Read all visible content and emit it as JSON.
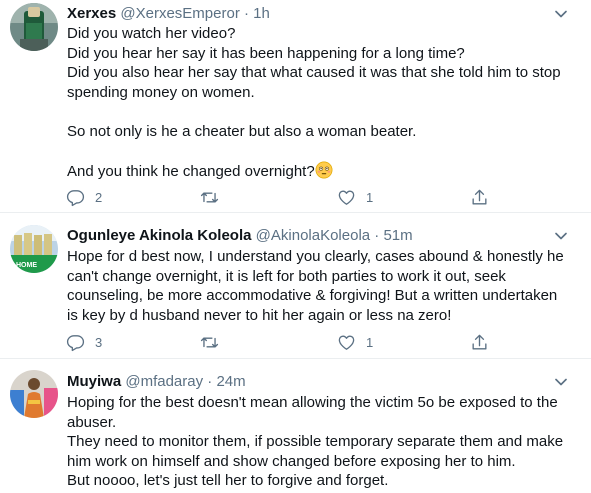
{
  "tweets": [
    {
      "name": "Xerxes",
      "handle": "@XerxesEmperor",
      "dot": "·",
      "time": "1h",
      "lines": [
        "Did you watch her video?",
        "Did you hear her say it has been happening for a long time?",
        "Did you also hear her say that what caused it was that she told him to stop",
        "spending money on women.",
        "",
        "So not only is he a cheater but also a woman beater.",
        "",
        "And you think he changed overnight?"
      ],
      "emoji": "flushed-face-emoji",
      "replies": "2",
      "retweets": "",
      "likes": "1"
    },
    {
      "name": "Ogunleye Akinola Koleola",
      "handle": "@AkinolaKoleola",
      "dot": "·",
      "time": "51m",
      "avatar_text": "HOME",
      "lines": [
        "Hope for d best now, I understand you clearly, cases abound & honestly he",
        "can't change overnight, it is left for both parties to work it out, seek",
        "counseling, be more accommodative & forgiving! But a written undertaken",
        "is key by d husband never to hit her again or less na zero!"
      ],
      "replies": "3",
      "retweets": "",
      "likes": "1"
    },
    {
      "name": "Muyiwa",
      "handle": "@mfadaray",
      "dot": "·",
      "time": "24m",
      "lines": [
        "Hoping for the best doesn't mean allowing the victim 5o be exposed to the",
        "abuser.",
        "They need to monitor them, if possible temporary separate them and make",
        "him work on himself and show changed before exposing her to him.",
        "But noooo, let's just tell her to forgive and forget."
      ]
    }
  ],
  "colors": {
    "text": "#0f1419",
    "secondary": "#5b7083",
    "divider": "#ebeef0"
  }
}
